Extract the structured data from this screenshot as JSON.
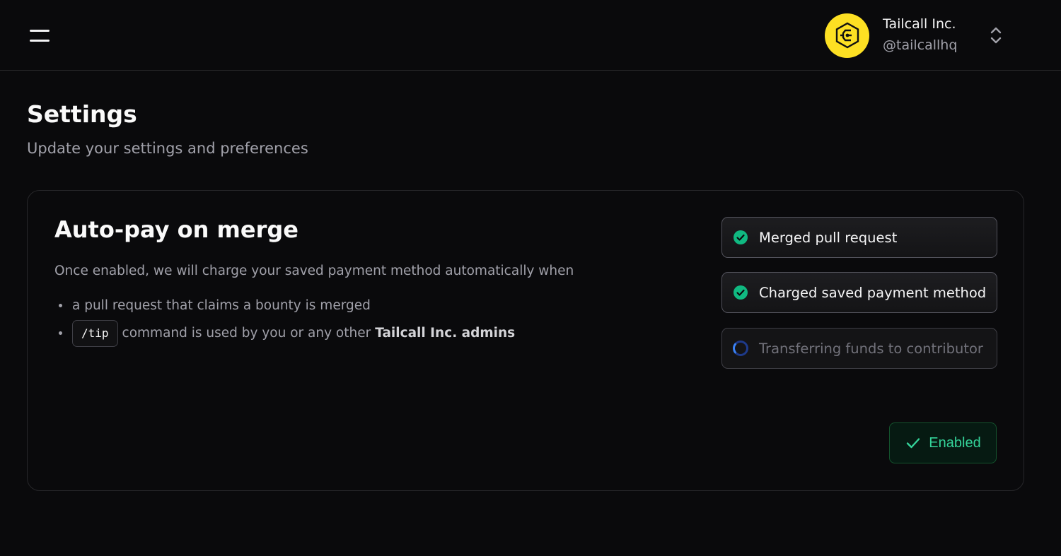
{
  "header": {
    "menu_icon": "hamburger-menu-icon",
    "org": {
      "name": "Tailcall Inc.",
      "handle": "@tailcallhq",
      "avatar_icon": "tailcall-logo-icon",
      "avatar_color": "#fde023",
      "switch_icon": "chevron-up-down-icon"
    }
  },
  "page": {
    "title": "Settings",
    "subtitle": "Update your settings and preferences"
  },
  "autopay": {
    "title": "Auto-pay on merge",
    "description": "Once enabled, we will charge your saved payment method automatically when",
    "bullets": {
      "first": "a pull request that claims a bounty is merged",
      "second_code": "/tip",
      "second_text": "command is used by you or any other",
      "second_strong": "Tailcall Inc. admins"
    },
    "steps": [
      {
        "label": "Merged pull request",
        "status": "complete",
        "icon": "check-circle-icon"
      },
      {
        "label": "Charged saved payment method",
        "status": "complete",
        "icon": "check-circle-icon"
      },
      {
        "label": "Transferring funds to contributor",
        "status": "in-progress",
        "icon": "spinner-icon"
      }
    ],
    "status_button": {
      "label": "Enabled",
      "icon": "check-icon"
    }
  },
  "colors": {
    "background": "#0a0a0c",
    "success": "#34d399",
    "spinner": "#3b82f6"
  }
}
